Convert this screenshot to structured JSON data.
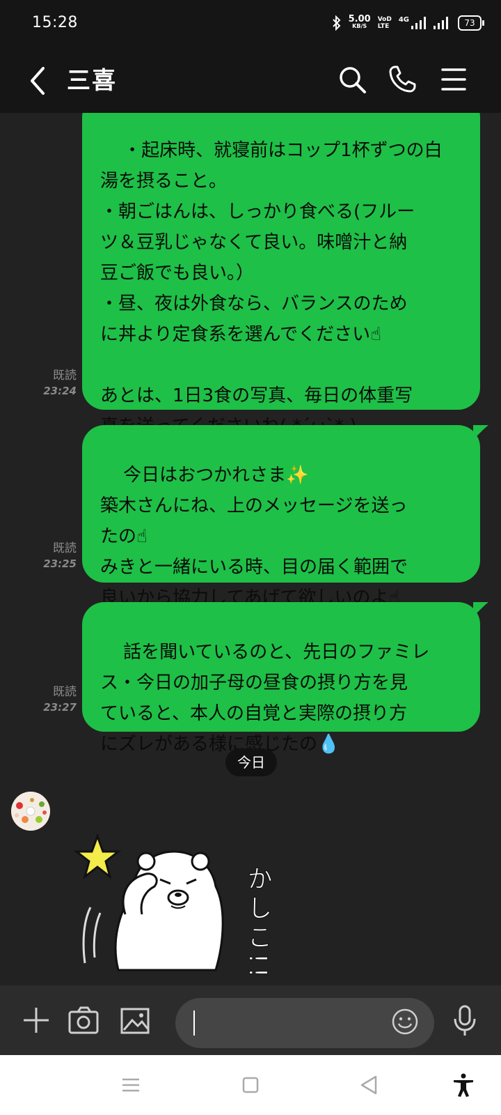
{
  "status_bar": {
    "time": "15:28",
    "net_speed_value": "5.00",
    "net_speed_unit": "KB/S",
    "volte_top": "VoD",
    "volte_bottom": "LTE",
    "network": "4G",
    "battery": "73"
  },
  "header": {
    "title": "三喜",
    "icons": [
      "back-icon",
      "search-icon",
      "phone-icon",
      "menu-icon"
    ]
  },
  "chat": {
    "messages": [
      {
        "text": "・起床時、就寝前はコップ1杯ずつの白\n湯を摂ること。\n・朝ごはんは、しっかり食べる(フルー\nツ＆豆乳じゃなくて良い。味噌汁と納\n豆ご飯でも良い。）\n・昼、夜は外食なら、バランスのため\nに丼より定食系を選んでください☝\n\nあとは、1日3食の写真、毎日の体重写\n真を送ってくださいね( *´ω`* )",
        "read": "既読",
        "time": "23:24"
      },
      {
        "text": "今日はおつかれさま✨\n築木さんにね、上のメッセージを送っ\nたの☝\nみきと一緒にいる時、目の届く範囲で\n良いから協力してあげて欲しいのよ☝",
        "read": "既読",
        "time": "23:25"
      },
      {
        "text": "話を聞いているのと、先日のファミレ\nス・今日の加子母の昼食の摂り方を見\nていると、本人の自覚と実際の摂り方\nにズレがある様に感じたの💧",
        "read": "既読",
        "time": "23:27"
      }
    ],
    "date_separator": "今日",
    "sticker_text": "かしこ!!"
  },
  "input_bar": {
    "placeholder": "",
    "icons": [
      "plus-icon",
      "camera-icon",
      "image-icon",
      "emoji-icon",
      "mic-icon"
    ]
  },
  "nav_bar": {
    "icons": [
      "recents-icon",
      "home-icon",
      "back-nav-icon",
      "accessibility-icon"
    ]
  },
  "colors": {
    "bubble": "#1ec047",
    "background": "#222222",
    "header": "#151515"
  }
}
